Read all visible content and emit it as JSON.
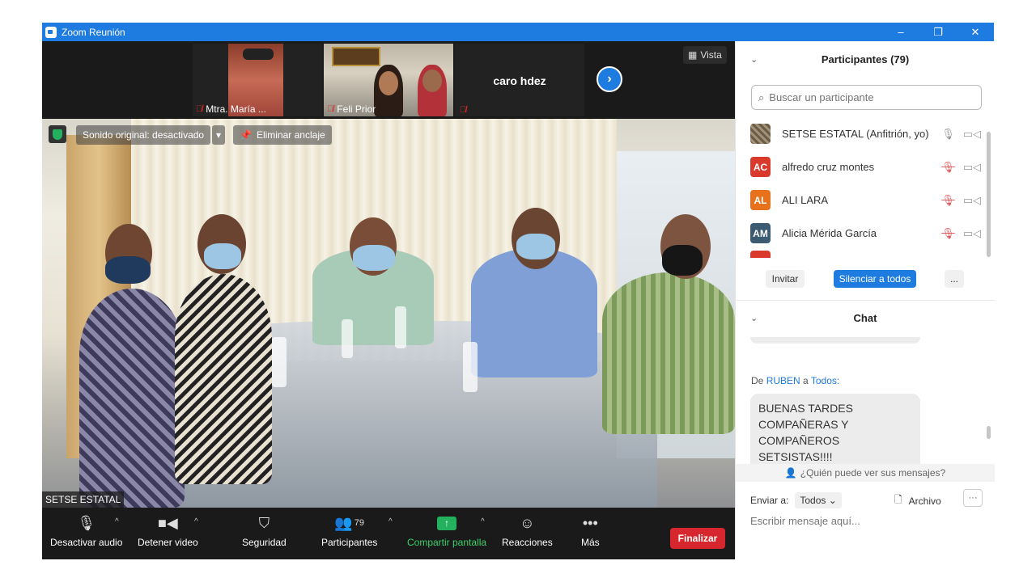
{
  "window": {
    "title": "Zoom Reunión",
    "minimize": "–",
    "maximize": "❐",
    "close": "✕"
  },
  "strip": {
    "thumbnails": [
      {
        "name": "Mtra. María ..."
      },
      {
        "name": "Feli Prior"
      },
      {
        "name": "caro hdez"
      }
    ],
    "view_label": "Vista"
  },
  "main_video": {
    "original_sound": "Sonido original: desactivado",
    "remove_pin": "Eliminar anclaje",
    "speaker_name": "SETSE ESTATAL"
  },
  "toolbar": {
    "mute": "Desactivar audio",
    "stop_video": "Detener video",
    "security": "Seguridad",
    "participants": "Participantes",
    "participants_count": "79",
    "share_screen": "Compartir pantalla",
    "reactions": "Reacciones",
    "more": "Más",
    "end": "Finalizar"
  },
  "participants_panel": {
    "title": "Participantes (79)",
    "search_placeholder": "Buscar un participante",
    "items": [
      {
        "initials": "",
        "name": "SETSE ESTATAL (Anfitrión, yo)",
        "color": "#6b5d4a"
      },
      {
        "initials": "AC",
        "name": "alfredo cruz montes",
        "color": "#d93a2b"
      },
      {
        "initials": "AL",
        "name": "ALI LARA",
        "color": "#e8711c"
      },
      {
        "initials": "AM",
        "name": "Alicia Mérida García",
        "color": "#3d5a73"
      }
    ],
    "invite": "Invitar",
    "mute_all": "Silenciar a todos",
    "more": "..."
  },
  "chat_panel": {
    "title": "Chat",
    "from_prefix": "De",
    "from_name": "RUBEN",
    "to_word": "a",
    "to_name": "Todos:",
    "message": "BUENAS TARDES COMPAÑERAS Y COMPAÑEROS SETSISTAS!!!!",
    "who_can_see": "¿Quién puede ver sus mensajes?",
    "send_to_label": "Enviar a:",
    "send_to_value": "Todos",
    "file_label": "Archivo",
    "more": "···",
    "input_placeholder": "Escribir mensaje aquí..."
  }
}
